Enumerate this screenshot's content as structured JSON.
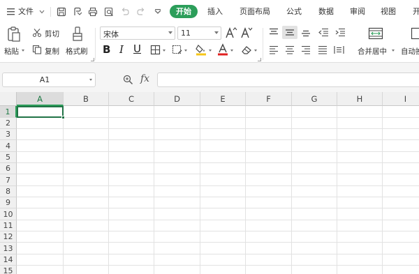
{
  "menu": {
    "file": "文件",
    "tabs": [
      "开始",
      "插入",
      "页面布局",
      "公式",
      "数据",
      "审阅",
      "视图"
    ],
    "tab_cut_off": "开"
  },
  "ribbon": {
    "paste": "粘贴",
    "cut": "剪切",
    "copy": "复制",
    "format_painter": "格式刷",
    "font_name": "宋体",
    "font_size": "11",
    "merge_center": "合并居中",
    "auto_wrap": "自动换"
  },
  "formula_bar": {
    "cell_ref": "A1",
    "fx_label": "fx",
    "formula_value": ""
  },
  "sheet": {
    "columns": [
      "A",
      "B",
      "C",
      "D",
      "E",
      "F",
      "G",
      "H",
      "I"
    ],
    "rows": [
      "1",
      "2",
      "3",
      "4",
      "5",
      "6",
      "7",
      "8",
      "9",
      "10",
      "11",
      "12",
      "13",
      "14",
      "15"
    ],
    "selected_cell": "A1"
  },
  "colors": {
    "accent": "#2c9e5a",
    "selection": "#217346",
    "font_color_bar": "#e02020",
    "fill_color_bar": "#f5c518"
  }
}
